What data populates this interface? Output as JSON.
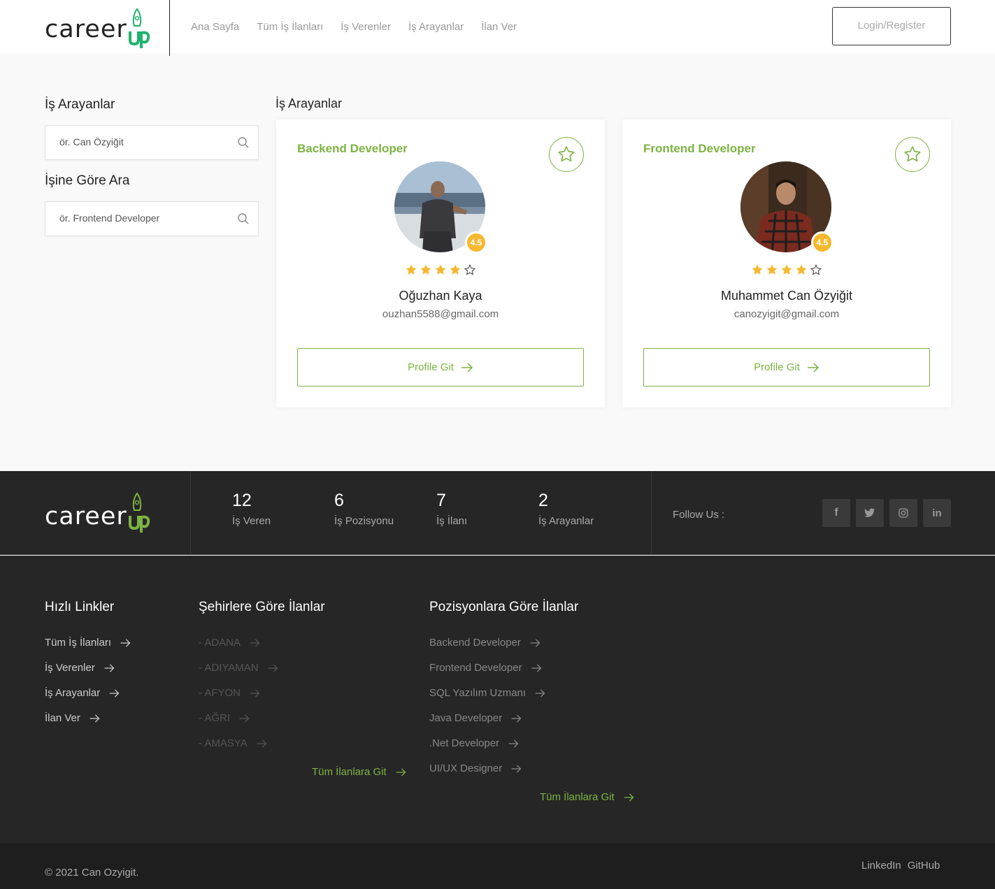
{
  "header": {
    "logo_main": "career",
    "logo_suffix": "up",
    "nav": [
      "Ana Sayfa",
      "Tüm İş İlanları",
      "İş Verenler",
      "İş Arayanlar",
      "İlan Ver"
    ],
    "login_label": "Login/Register"
  },
  "sidebar": {
    "title1": "İş Arayanlar",
    "search1_placeholder": "ör. Can Özyiğit",
    "title2": "İşine Göre Ara",
    "search2_placeholder": "ör. Frontend Developer"
  },
  "main": {
    "title": "İş Arayanlar",
    "cards": [
      {
        "role": "Backend Developer",
        "rating": "4.5",
        "stars": 4,
        "name": "Oğuzhan Kaya",
        "email": "ouzhan5588@gmail.com",
        "button": "Profile Git"
      },
      {
        "role": "Frontend Developer",
        "rating": "4.5",
        "stars": 4,
        "name": "Muhammet Can Özyiğit",
        "email": "canozyigit@gmail.com",
        "button": "Profile Git"
      }
    ]
  },
  "footer": {
    "stats": [
      {
        "num": "12",
        "label": "İş Veren"
      },
      {
        "num": "6",
        "label": "İş Pozisyonu"
      },
      {
        "num": "7",
        "label": "İş İlanı"
      },
      {
        "num": "2",
        "label": "İş Arayanlar"
      }
    ],
    "follow_label": "Follow Us :",
    "social_icons": [
      "facebook-icon",
      "twitter-icon",
      "instagram-icon",
      "linkedin-icon"
    ],
    "quick_title": "Hızlı Linkler",
    "quick_links": [
      "Tüm İş İlanları",
      "İş Verenler",
      "İş Arayanlar",
      "İlan Ver"
    ],
    "city_title": "Şehirlere Göre İlanlar",
    "city_links": [
      "- ADANA",
      "- ADIYAMAN",
      "- AFYON",
      "- AĞRI",
      "- AMASYA"
    ],
    "city_all": "Tüm İlanlara Git",
    "pos_title": "Pozisyonlara Göre İlanlar",
    "pos_links": [
      "Backend Developer",
      "Frontend Developer",
      "SQL Yazılım Uzmanı",
      "Java Developer",
      ".Net Developer",
      "UI/UX Designer"
    ],
    "pos_all": "Tüm İlanlara Git",
    "copyright": "© 2021 Can Ozyigit.",
    "bottom_links": [
      "LinkedIn",
      "GitHub"
    ]
  },
  "colors": {
    "accent": "#7cb342",
    "logo_green": "#1fb36b",
    "star": "#f5b82e",
    "footer_bg": "#262626"
  }
}
